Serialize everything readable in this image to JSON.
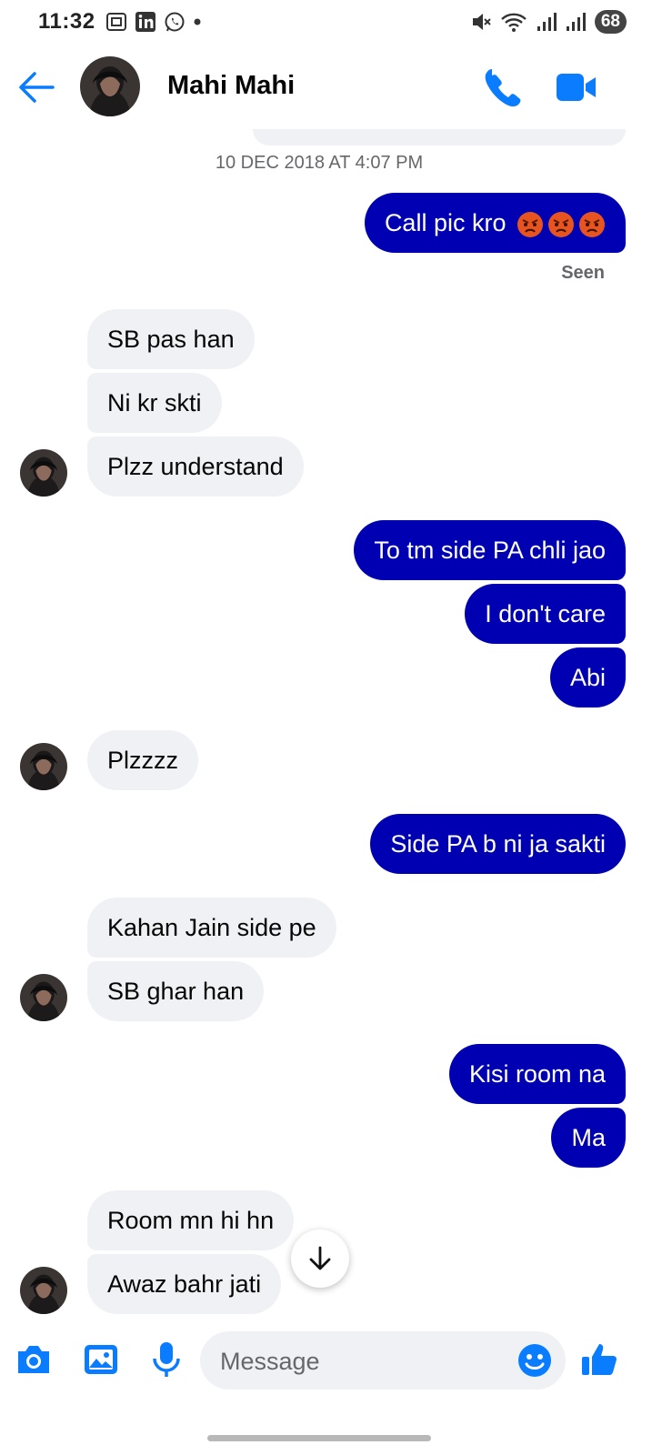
{
  "status_bar": {
    "time": "11:32",
    "battery": "68",
    "left_icons": [
      "screenshot-icon",
      "linkedin-icon",
      "whatsapp-icon",
      "dot-icon"
    ],
    "right_icons": [
      "mute-icon",
      "wifi-icon",
      "signal-icon",
      "signal-icon"
    ]
  },
  "header": {
    "contact_name": "Mahi Mahi",
    "accent_color": "#0a7cff"
  },
  "conversation": {
    "timestamp": "10 DEC 2018 AT 4:07 PM",
    "seen_label": "Seen",
    "outgoing_color": "#0000b3",
    "incoming_color": "#f0f1f5",
    "messages": [
      {
        "dir": "out",
        "text": "Call pic kro",
        "emoji": [
          "angry-face",
          "angry-face",
          "angry-face"
        ]
      },
      {
        "dir": "in",
        "text": "SB pas han"
      },
      {
        "dir": "in",
        "text": "Ni kr  skti"
      },
      {
        "dir": "in",
        "text": "Plzz understand"
      },
      {
        "dir": "out",
        "text": "To tm side PA chli jao"
      },
      {
        "dir": "out",
        "text": "I don't care"
      },
      {
        "dir": "out",
        "text": "Abi"
      },
      {
        "dir": "in",
        "text": "Plzzzz"
      },
      {
        "dir": "out",
        "text": "Side PA b ni ja sakti"
      },
      {
        "dir": "in",
        "text": "Kahan Jain side pe"
      },
      {
        "dir": "in",
        "text": "SB ghar han"
      },
      {
        "dir": "out",
        "text": "Kisi room na"
      },
      {
        "dir": "out",
        "text": "Ma"
      },
      {
        "dir": "in",
        "text": "Room mn hi hn"
      },
      {
        "dir": "in",
        "text": "Awaz bahr jati"
      }
    ]
  },
  "composer": {
    "placeholder": "Message",
    "icons": [
      "camera-icon",
      "gallery-icon",
      "microphone-icon",
      "emoji-icon",
      "thumbs-up-icon"
    ]
  }
}
